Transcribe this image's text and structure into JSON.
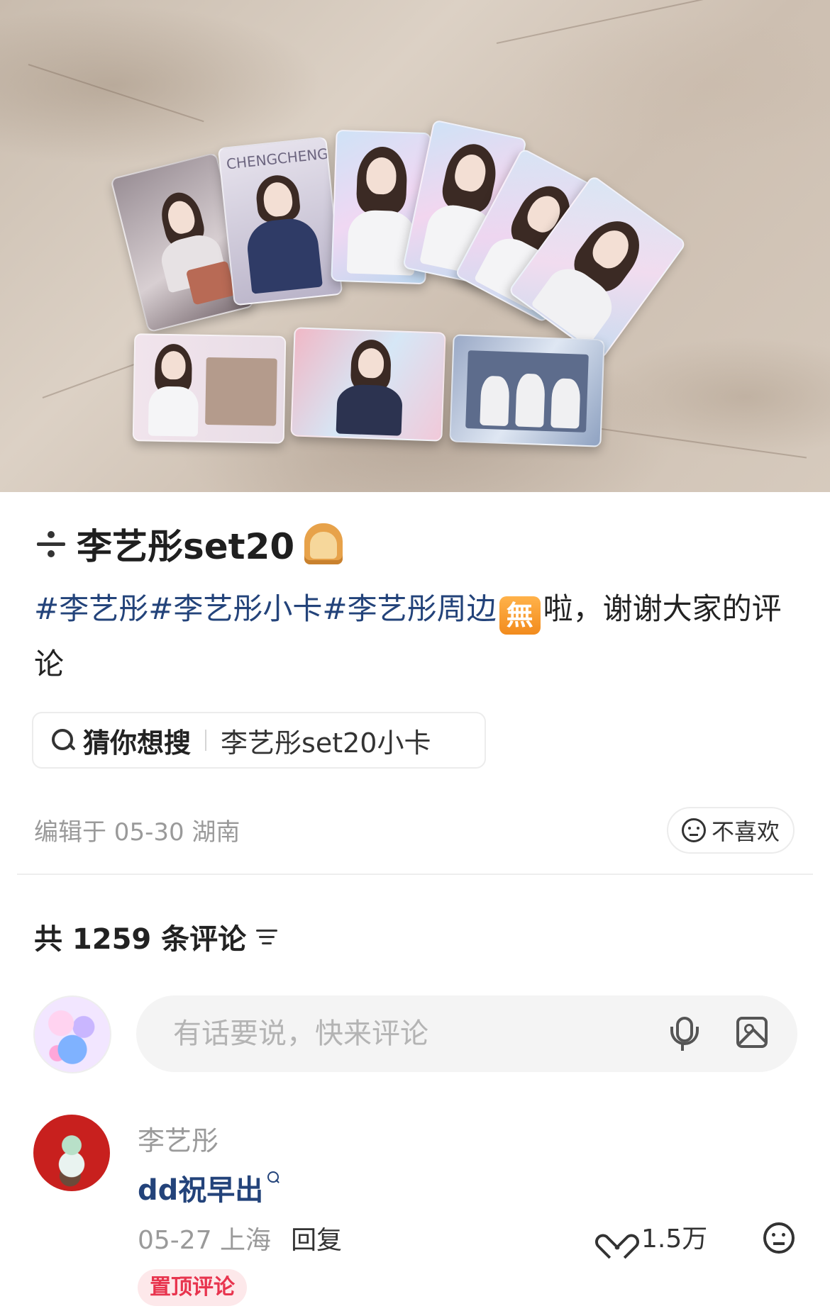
{
  "post": {
    "title": "李艺彤set20",
    "title_icons": [
      "divide-icon",
      "bread-icon"
    ],
    "hashtags": [
      "#李艺彤",
      "#李艺彤小卡",
      "#李艺彤周边"
    ],
    "badge_text": "無",
    "description_tail": "啦，谢谢大家的评论",
    "search_suggestion": {
      "label": "猜你想搜",
      "term": "李艺彤set20小卡"
    },
    "edit_info": "编辑于 05-30 湖南",
    "dislike_label": "不喜欢"
  },
  "comments": {
    "count_label": "共 1259 条评论",
    "input_placeholder": "有话要说，快来评论",
    "items": [
      {
        "username": "李艺彤",
        "text": "dd祝早出",
        "date_location": "05-27 上海",
        "reply_label": "回复",
        "likes": "1.5万",
        "badge": "置顶评论"
      }
    ]
  },
  "colors": {
    "hashtag": "#23437a",
    "pinned_badge_bg": "#fde8ea",
    "pinned_badge_text": "#e8344e"
  }
}
